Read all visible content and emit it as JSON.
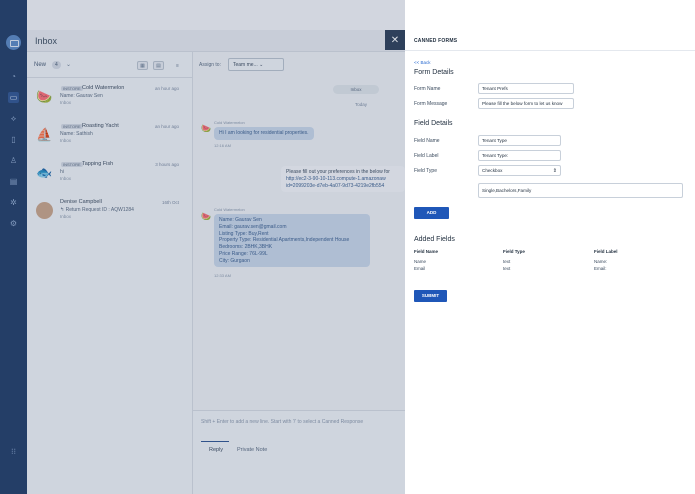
{
  "app": {
    "inbox_title": "Inbox",
    "new_label": "New",
    "new_count": "4",
    "assign_to": "Assign to:",
    "team_button": "Team me...",
    "close_glyph": "✕"
  },
  "conversations": [
    {
      "badge": "INSTORE",
      "title": "Cold Watermelon",
      "time": "an hour ago",
      "line2": "Name: Gaurav Sen",
      "line3": "Inbox",
      "avatar": "🍉"
    },
    {
      "badge": "INSTORE",
      "title": "Roasting Yacht",
      "time": "an hour ago",
      "line2": "Name: Sathish",
      "line3": "Inbox",
      "avatar": "⛵"
    },
    {
      "badge": "INSTORE",
      "title": "Tapping Fish",
      "time": "3 hours ago",
      "line2": "hi",
      "line3": "Inbox",
      "avatar": "🐟"
    },
    {
      "badge": "",
      "title": "Denise Campbell",
      "time": "16th Oct",
      "line2": "↰ Return Request ID : AQW1284",
      "line3": "Inbox",
      "avatar": ""
    }
  ],
  "chat": {
    "pill_inbox": "Inbox",
    "today": "Today",
    "sender1": "Cold Watermelon",
    "msg1": "Hi I am looking for residential properties.",
    "time1": "12:16 AM",
    "msg2_lines": [
      "Please fill out your preferences in the below for",
      "http://ec2-3-90-10-113.compute-1.amazonaw",
      "id=2099203e-d7eb-4a07-9d73-4219e2fb554"
    ],
    "sender2": "Cold Watermelon",
    "msg3_lines": [
      "Name: Gaurav Sen",
      "Email: gaurav.sen@gmail.com",
      "Listing Type: Buy,Rent",
      "Property Type: Residential Apartments,Independent House",
      "Bedrooms: 2BHK,3BHK",
      "Price Range: 76L-99L",
      "City: Gurgaon"
    ],
    "time3": "12:33 AM",
    "composer_hint": "Shift + Enter to add a new line. Start with '/' to select a Canned Response",
    "tab_reply": "Reply",
    "tab_private": "Private Note"
  },
  "panel": {
    "title": "CANNED FORMS",
    "back": "<< Back",
    "form_details": "Form Details",
    "form_name_label": "Form Name",
    "form_name_value": "Tenant Prefs",
    "form_message_label": "Form Message",
    "form_message_value": "Please fill the below form to let us know",
    "field_details": "Field Details",
    "field_name_label": "Field Name",
    "field_name_value": "Tenant Type",
    "field_label_label": "Field Label",
    "field_label_value": "Tenant Type:",
    "field_type_label": "Field Type",
    "field_type_value": "Checkbox",
    "options_value": "Single,Bachelors,Family",
    "add_button": "ADD",
    "added_fields": "Added Fields",
    "columns": [
      "Field Name",
      "Field Type",
      "Field Label"
    ],
    "rows": [
      [
        "Name",
        "text",
        "Name:"
      ],
      [
        "Email",
        "text",
        "Email:"
      ]
    ],
    "submit_button": "SUBMIT"
  },
  "colors": {
    "rail": "#1f3b66",
    "accent": "#1f57b8",
    "link": "#2a6bd1"
  }
}
